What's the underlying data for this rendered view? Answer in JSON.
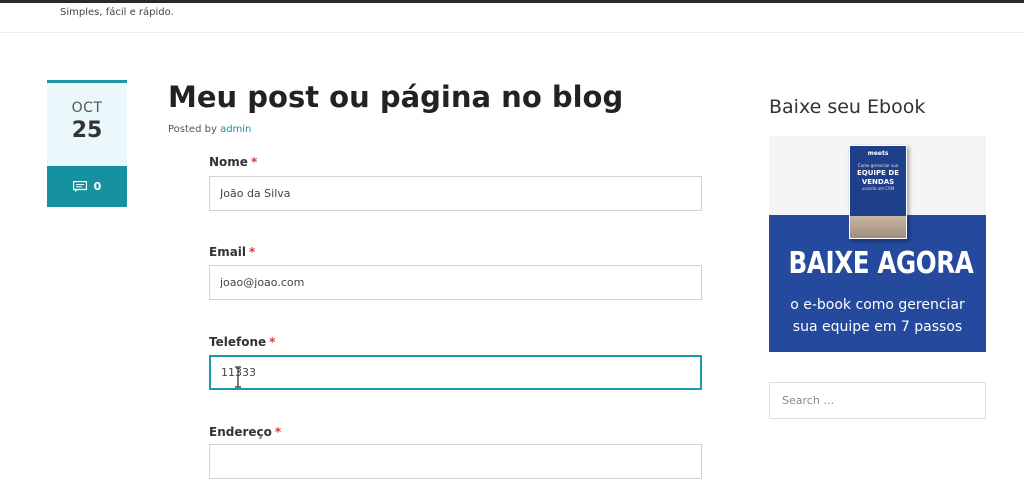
{
  "site": {
    "tagline": "Simples, fácil e rápido."
  },
  "post": {
    "date": {
      "month": "OCT",
      "day": "25",
      "comments": "0"
    },
    "title": "Meu post ou página no blog",
    "posted_by": "Posted by",
    "author": "admin"
  },
  "form": {
    "required_mark": "*",
    "fields": [
      {
        "label": "Nome",
        "value": "João da Silva"
      },
      {
        "label": "Email",
        "value": "joao@joao.com"
      },
      {
        "label": "Telefone",
        "value": "11333"
      },
      {
        "label": "Endereço",
        "value": ""
      }
    ]
  },
  "sidebar": {
    "widget_title": "Baixe seu Ebook",
    "banner": {
      "book_brand": "meets",
      "book_line": "Como gerenciar sua",
      "book_title_1": "EQUIPE DE",
      "book_title_2": "VENDAS",
      "book_sub": "usando um CRM",
      "headline": "BAIXE AGORA",
      "line1": "o e-book como gerenciar",
      "line2": "sua equipe em 7 passos"
    },
    "search": {
      "placeholder": "Search …"
    }
  },
  "colors": {
    "accent": "#17919f",
    "banner_blue": "#25499c",
    "required": "#d63c3c"
  }
}
